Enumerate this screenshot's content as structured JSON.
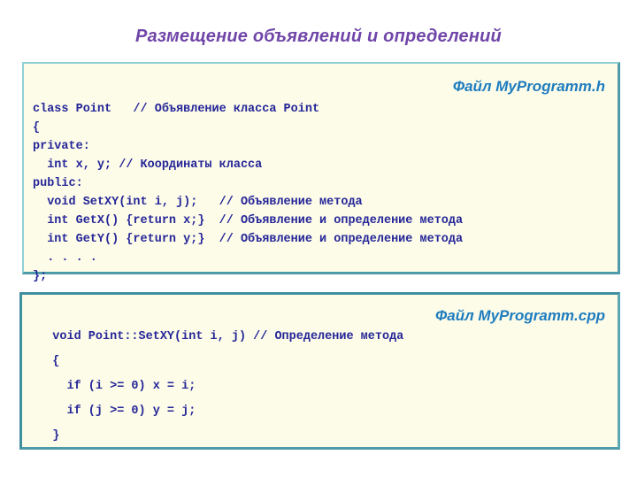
{
  "slide": {
    "title": "Размещение объявлений и определений",
    "title_color": "#7046a8",
    "background_color": "#ffffff"
  },
  "boxes": [
    {
      "id": "header-file",
      "file_label": "Файл MyProgramm.h",
      "file_label_color": "#1f7cbf",
      "background_color": "#fcfce8",
      "border_color_light": "#8fd0d6",
      "border_color_dark": "#4e9aa8",
      "code_color": "#262699",
      "lines": [
        "class Point   // Объявление класса Point",
        "{",
        "private:",
        "  int x, y; // Координаты класса",
        "public:",
        "  void SetXY(int i, j);   // Объявление метода",
        "  int GetX() {return x;}  // Объявление и определение метода",
        "  int GetY() {return y;}  // Объявление и определение метода",
        "  . . . .",
        "};"
      ]
    },
    {
      "id": "cpp-file",
      "file_label": "Файл MyProgramm.cpp",
      "file_label_color": "#1f7cbf",
      "background_color": "#fcfce8",
      "border_color_light": "#5aa8b4",
      "border_color_dark": "#3f8f9e",
      "code_color": "#262699",
      "lines": [
        "   void Point::SetXY(int i, j) // Определение метода",
        "   {",
        "     if (i >= 0) x = i;",
        "     if (j >= 0) y = j;",
        "   }"
      ]
    }
  ]
}
